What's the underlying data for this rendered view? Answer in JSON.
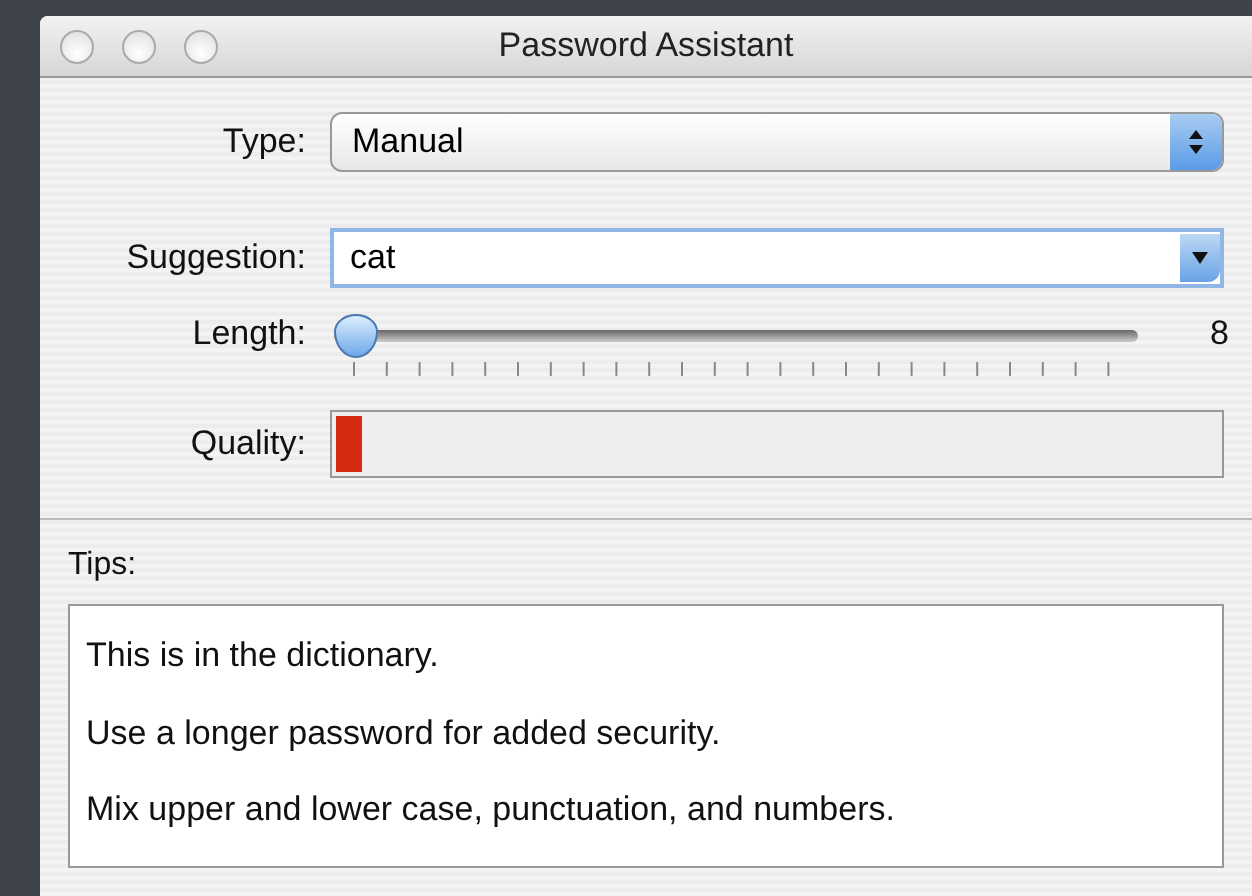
{
  "window": {
    "title": "Password Assistant"
  },
  "type": {
    "label": "Type:",
    "value": "Manual"
  },
  "suggestion": {
    "label": "Suggestion:",
    "value": "cat"
  },
  "length": {
    "label": "Length:",
    "level": 0,
    "reading": "8"
  },
  "quality": {
    "label": "Quality:",
    "level": 0.03
  },
  "tips": {
    "label": "Tips:",
    "lines": [
      "This is in the dictionary.",
      "Use a longer password for added security.",
      "Mix upper and lower case, punctuation, and numbers."
    ]
  }
}
